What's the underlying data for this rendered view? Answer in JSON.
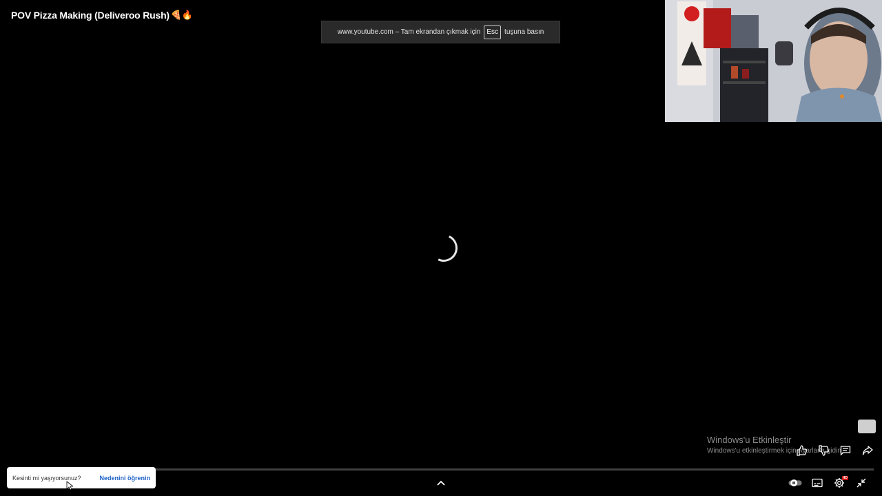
{
  "video": {
    "title": "POV Pizza Making (Deliveroo Rush)",
    "title_emojis": "🍕🔥"
  },
  "fullscreen_banner": {
    "prefix": "www.youtube.com – Tam ekrandan çıkmak için",
    "key": "Esc",
    "suffix": "tuşuna basın"
  },
  "watermark": {
    "title": "Windows'u Etkinleştir",
    "subtitle": "Windows'u etkinleştirmek için Ayarlar'a gidin."
  },
  "toast": {
    "message": "Kesinti mi yaşıyorsunuz?",
    "link": "Nedenini öğrenin"
  },
  "icons": {
    "like": "thumbs-up-icon",
    "dislike": "thumbs-down-icon",
    "comments": "comments-icon",
    "share": "share-icon",
    "autoplay": "autoplay-toggle-icon",
    "subtitles": "subtitles-icon",
    "settings": "gear-icon",
    "exit_fullscreen": "exit-fullscreen-icon",
    "expand": "chevron-up-icon"
  },
  "settings_badge": "HD",
  "colors": {
    "background": "#000000",
    "banner": "#2a2a2a",
    "link": "#1a5fc5",
    "badge": "#cc0000"
  }
}
